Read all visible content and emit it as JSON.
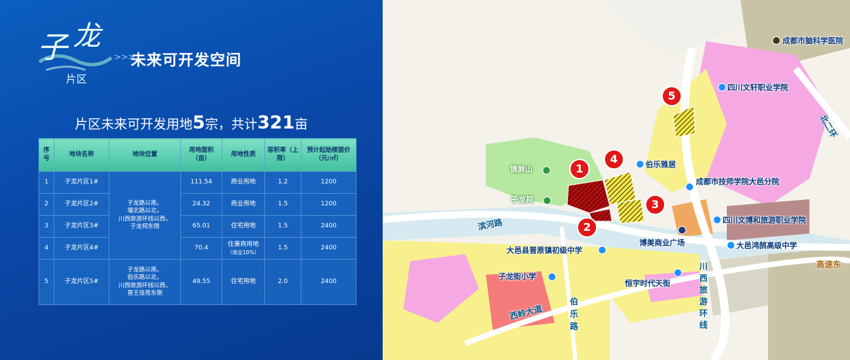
{
  "logo": {
    "char1": "子",
    "char2": "龙",
    "sub": "片区",
    "arrows": ">>>",
    "title": "未来可开发空间"
  },
  "summary": {
    "prefix": "片区未来可开发用地",
    "count": "5",
    "mid": "宗，共计",
    "total": "321",
    "unit": "亩"
  },
  "table": {
    "headers": [
      "序号",
      "地块名称",
      "地块位置",
      "用地面积（亩）",
      "用地性质",
      "容积率（上限）",
      "预计起始楼面价（元/㎡）"
    ],
    "rows": [
      {
        "no": "1",
        "name": "子龙片区1#",
        "area": "111.54",
        "use": "商业用地",
        "far": "1.2",
        "price": "1200"
      },
      {
        "no": "2",
        "name": "子龙片区2#",
        "area": "24.32",
        "use": "商业用地",
        "far": "1.5",
        "price": "1200"
      },
      {
        "no": "3",
        "name": "子龙片区3#",
        "area": "65.01",
        "use": "住宅用地",
        "far": "1.5",
        "price": "2400"
      },
      {
        "no": "4",
        "name": "子龙片区4#",
        "area": "70.4",
        "use": "住兼商用地",
        "use_note": "（商业10%）",
        "far": "1.5",
        "price": "2400"
      },
      {
        "no": "5",
        "name": "子龙片区5#",
        "area": "49.55",
        "use": "住宅用地",
        "far": "2.0",
        "price": "2400"
      }
    ],
    "location_a": [
      "子龙路以南，",
      "壤北路以北，",
      "川西旅游环线以西，",
      "子龙祠东侧"
    ],
    "location_b": [
      "子龙路以南，",
      "伯乐路以北，",
      "川西旅游环线以西，",
      "晋王佳苑东侧"
    ]
  },
  "map": {
    "markers": [
      "1",
      "2",
      "3",
      "4",
      "5"
    ],
    "places": {
      "hospital": "成都市脑科学医院",
      "wenxuan": "四川文轩职业学院",
      "bole": "伯乐雅居",
      "jishi": "成都市技师学院大邑分院",
      "wenbo": "四川文博和旅游职业学院",
      "hongxi": "大邑鸿鹄高级中学",
      "jinping": "锦屏山",
      "zilongci": "子龙祠",
      "jinyuan": "大邑县晋原镇初级中学",
      "bomei": "博美商业广场",
      "zilongjie": "子龙街小学",
      "hengyu": "恒宇时代天街"
    },
    "roads": {
      "binhe": "滨河路",
      "bei2": "北二环",
      "xiling": "西岭大道",
      "bole_road": "伯乐路",
      "chuanxi": "川西旅游环线",
      "gaosu": "高速东"
    },
    "colors": {
      "marker": "#e01818",
      "school_dot": "#1e90ff",
      "park_dot": "#2e9b3e",
      "hospital_dot": "#3a3a1a"
    }
  }
}
